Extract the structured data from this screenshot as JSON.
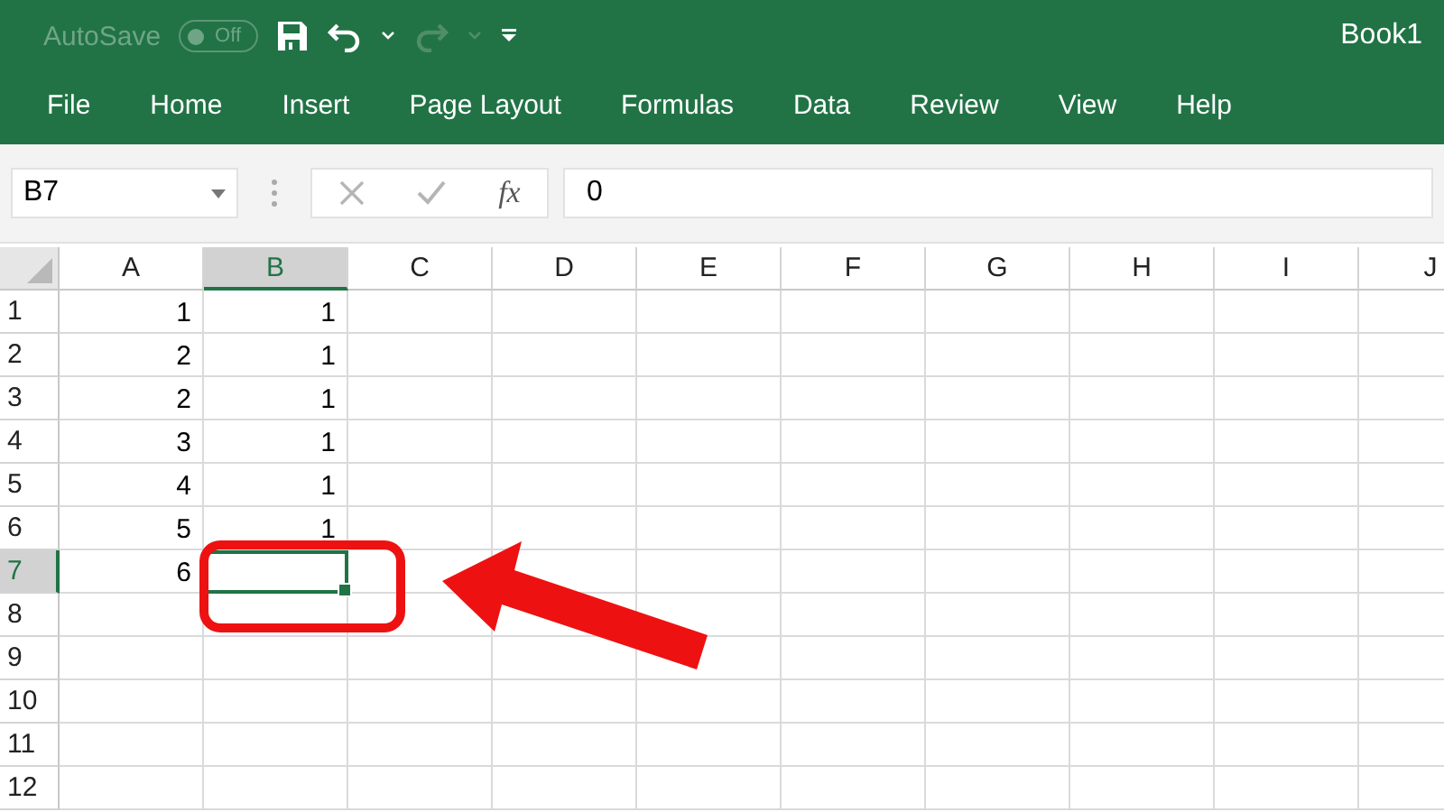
{
  "title_bar": {
    "autosave_label": "AutoSave",
    "autosave_toggle": {
      "text": "Off",
      "on": false
    },
    "title": "Book1"
  },
  "tabs": [
    {
      "label": "File",
      "selected": false
    },
    {
      "label": "Home",
      "selected": false
    },
    {
      "label": "Insert",
      "selected": false
    },
    {
      "label": "Page Layout",
      "selected": false
    },
    {
      "label": "Formulas",
      "selected": false
    },
    {
      "label": "Data",
      "selected": false
    },
    {
      "label": "Review",
      "selected": false
    },
    {
      "label": "View",
      "selected": false
    },
    {
      "label": "Help",
      "selected": false
    }
  ],
  "formula_bar": {
    "name_box": "B7",
    "function_label": "fx",
    "value": "0"
  },
  "sheet": {
    "columns": [
      {
        "label": "A",
        "selected": false
      },
      {
        "label": "B",
        "selected": true
      },
      {
        "label": "C",
        "selected": false
      },
      {
        "label": "D",
        "selected": false
      },
      {
        "label": "E",
        "selected": false
      },
      {
        "label": "F",
        "selected": false
      },
      {
        "label": "G",
        "selected": false
      },
      {
        "label": "H",
        "selected": false
      },
      {
        "label": "I",
        "selected": false
      },
      {
        "label": "J",
        "selected": false
      }
    ],
    "rows": [
      {
        "label": "1",
        "selected": false,
        "cells": [
          "1",
          "1"
        ]
      },
      {
        "label": "2",
        "selected": false,
        "cells": [
          "2",
          "1"
        ]
      },
      {
        "label": "3",
        "selected": false,
        "cells": [
          "2",
          "1"
        ]
      },
      {
        "label": "4",
        "selected": false,
        "cells": [
          "3",
          "1"
        ]
      },
      {
        "label": "5",
        "selected": false,
        "cells": [
          "4",
          "1"
        ]
      },
      {
        "label": "6",
        "selected": false,
        "cells": [
          "5",
          "1"
        ]
      },
      {
        "label": "7",
        "selected": true,
        "cells": [
          "6"
        ]
      },
      {
        "label": "8",
        "selected": false
      },
      {
        "label": "9",
        "selected": false
      },
      {
        "label": "10",
        "selected": false
      },
      {
        "label": "11",
        "selected": false
      },
      {
        "label": "12",
        "selected": false
      }
    ]
  }
}
